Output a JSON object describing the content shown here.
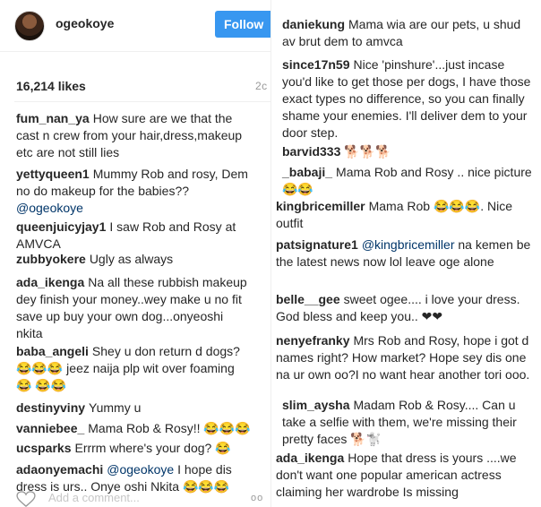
{
  "post": {
    "username": "ogeokoye",
    "follow_label": "Follow",
    "likes": "16,214 likes",
    "time": "2c",
    "add_comment_placeholder": "Add a comment...",
    "more_label": "oo"
  },
  "left_comments": [
    {
      "user": "fum_nan_ya",
      "text": "How sure are we that the cast n crew from your hair,dress,makeup etc are not still lies"
    },
    {
      "user": "yettyqueen1",
      "text": "Mummy Rob and rosy, Dem no do makeup for the babies??",
      "mention": "@ogeokoye"
    },
    {
      "user": "queenjuicyjay1",
      "text": "I saw Rob and Rosy at AMVCA"
    },
    {
      "user": "zubbyokere",
      "text": "Ugly as always"
    },
    {
      "user": "ada_ikenga",
      "text": "Na all these rubbish makeup dey finish your money..wey make u no fit save up buy your own dog...onyeoshi nkita"
    },
    {
      "user": "baba_angeli",
      "text": "Shey u don return d dogs? 😂😂😂 jeez naija plp wit over foaming 😂 😂😂"
    },
    {
      "user": "destinyviny",
      "text": "Yummy u"
    },
    {
      "user": "vanniebee_",
      "text": "Mama Rob & Rosy!! 😂😂😂"
    },
    {
      "user": "ucsparks",
      "text": "Errrm where's your dog? 😂"
    },
    {
      "user": "adaonyemachi",
      "mention": "@ogeokoye",
      "text": "I hope dis dress is urs.. Onye oshi Nkita 😂😂😂"
    }
  ],
  "right_comments": [
    {
      "user": "daniekung",
      "text": "Mama wia are our pets, u shud av brut dem to amvca"
    },
    {
      "user": "since17n59",
      "text": "Nice 'pinshure'...just incase you'd like to get those per dogs, I have those exact types no difference, so you can finally shame your enemies. I'll deliver dem to your door step."
    },
    {
      "user": "barvid333",
      "text": "🐕🐕🐕"
    },
    {
      "user": "_babaji_",
      "text": "Mama Rob and Rosy .. nice picture 😂😂"
    },
    {
      "user": "kingbricemiller",
      "text": "Mama Rob 😂😂😂. Nice outfit"
    },
    {
      "user": "patsignature1",
      "mention": "@kingbricemiller",
      "text": "na kemen be the latest news now lol leave oge alone"
    },
    {
      "user": "belle__gee",
      "text": "sweet ogee.... i love your dress. God bless and keep you.. ❤❤"
    },
    {
      "user": "nenyefranky",
      "text": "Mrs Rob and Rosy, hope i got d names right? How market? Hope sey dis one na ur own oo?I no want hear another tori ooo."
    },
    {
      "user": "slim_aysha",
      "text": "Madam Rob & Rosy.... Can u take a selfie with them, we're missing their pretty faces 🐕🐩"
    },
    {
      "user": "ada_ikenga",
      "text": "Hope that dress is yours ....we don't want one popular american actress claiming her wardrobe Is missing"
    }
  ]
}
